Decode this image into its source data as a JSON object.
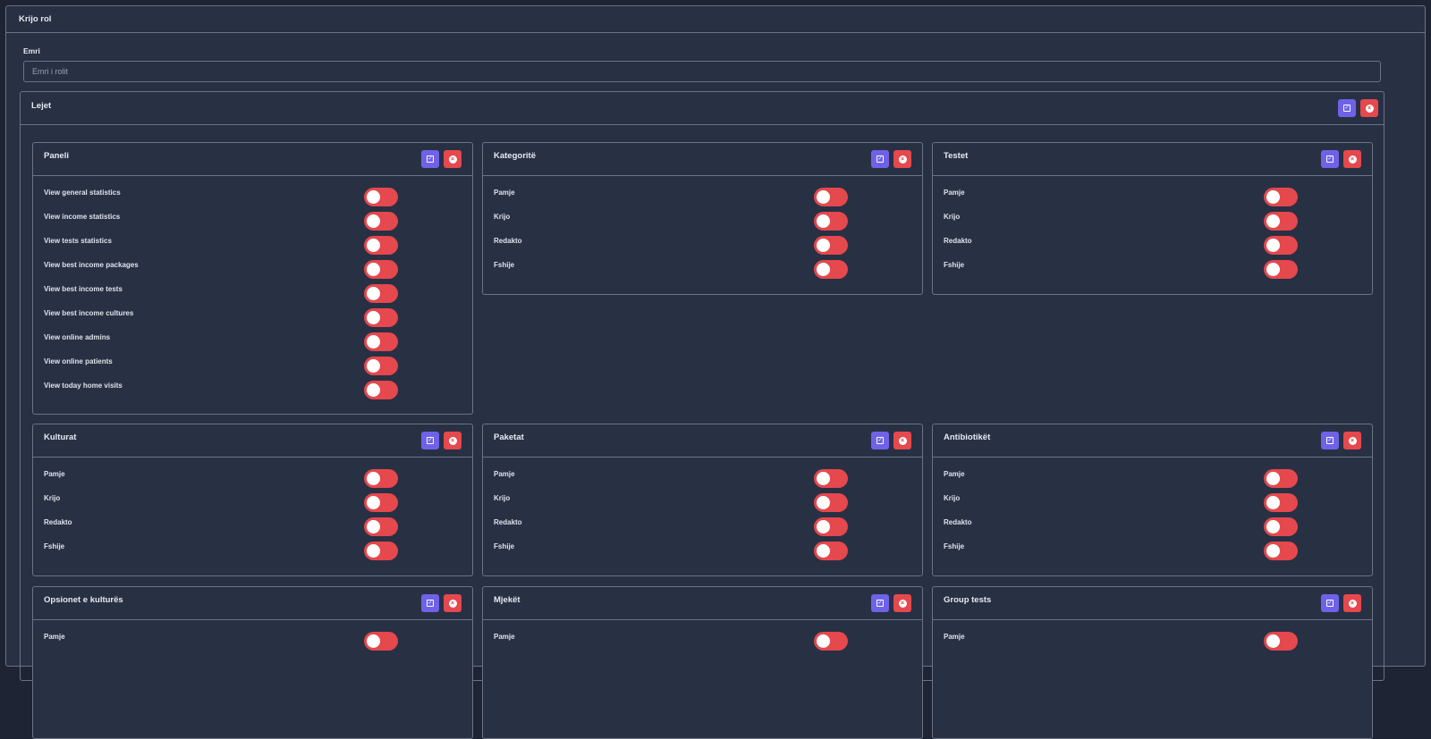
{
  "page": {
    "title": "Krijo rol"
  },
  "name_field": {
    "label": "Emri",
    "placeholder": "Emri i rolit",
    "value": ""
  },
  "permissions": {
    "title": "Lejet",
    "groups": [
      {
        "title": "Paneli",
        "items": [
          "View general statistics",
          "View income statistics",
          "View tests statistics",
          "View best income packages",
          "View best income tests",
          "View best income cultures",
          "View online admins",
          "View online patients",
          "View today home visits"
        ]
      },
      {
        "title": "Kategoritë",
        "items": [
          "Pamje",
          "Krijo",
          "Redakto",
          "Fshije"
        ]
      },
      {
        "title": "Testet",
        "items": [
          "Pamje",
          "Krijo",
          "Redakto",
          "Fshije"
        ]
      },
      {
        "title": "Kulturat",
        "items": [
          "Pamje",
          "Krijo",
          "Redakto",
          "Fshije"
        ]
      },
      {
        "title": "Paketat",
        "items": [
          "Pamje",
          "Krijo",
          "Redakto",
          "Fshije"
        ]
      },
      {
        "title": "Antibiotikët",
        "items": [
          "Pamje",
          "Krijo",
          "Redakto",
          "Fshije"
        ]
      },
      {
        "title": "Opsionet e kulturës",
        "items": [
          "Pamje"
        ]
      },
      {
        "title": "Mjekët",
        "items": [
          "Pamje"
        ]
      },
      {
        "title": "Group tests",
        "items": [
          "Pamje"
        ]
      }
    ]
  },
  "colors": {
    "select_all": "#6f62e8",
    "deselect_all": "#e5484d",
    "toggle_off": "#e5484d",
    "background": "#283044"
  },
  "icons": {
    "select_all": "check-square-icon",
    "deselect_all": "x-circle-icon"
  }
}
